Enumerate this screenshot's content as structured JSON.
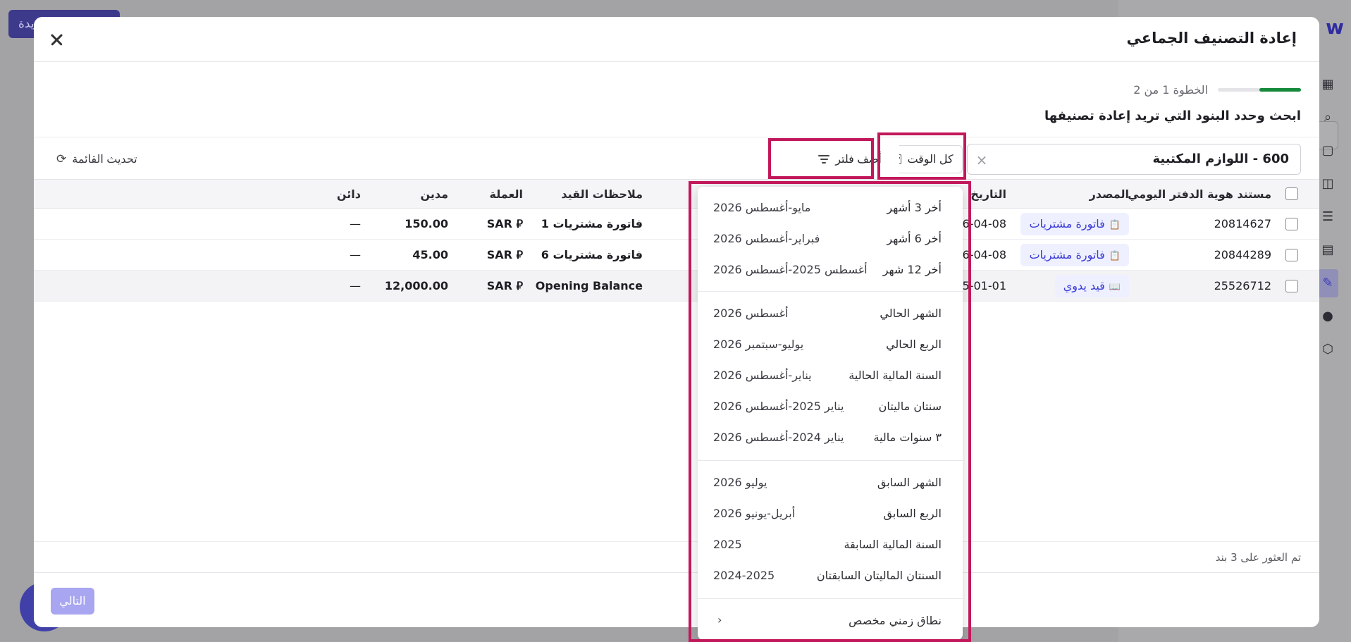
{
  "background": {
    "top_button_label": "يدة",
    "logo": "w"
  },
  "modal": {
    "title": "إعادة التصنيف الجماعي",
    "step": {
      "label": "الخطوة 1 من 2",
      "progress": 0.5
    },
    "section_title": "ابحث وحدد البنود التي تريد إعادة تصنيفها",
    "account_filter": {
      "value": "600 - اللوازم المكتبية"
    },
    "time_filter_label": "كل الوقت",
    "add_filter_label": "أضف فلتر",
    "refresh_label": "تحديث القائمة",
    "table": {
      "headers": {
        "doc_id": "مستند هوية الدفتر اليومي",
        "source": "المصدر",
        "date": "التاريخ",
        "notes": "ملاحظات القيد",
        "currency": "العملة",
        "debit": "مدين",
        "credit": "دائن"
      },
      "rows": [
        {
          "doc_id": "20814627",
          "source": "فاتورة مشتريات",
          "date": "6-04-08",
          "notes": "فاتورة مشتريات 1",
          "currency": "SAR ⃁",
          "debit": "150.00",
          "credit": "—"
        },
        {
          "doc_id": "20844289",
          "source": "فاتورة مشتريات",
          "date": "6-04-08",
          "notes": "فاتورة مشتريات 6",
          "currency": "SAR ⃁",
          "debit": "45.00",
          "credit": "—"
        },
        {
          "doc_id": "25526712",
          "source": "قيد يدوي",
          "date": "5-01-01",
          "notes": "Opening Balance",
          "currency": "SAR ⃁",
          "debit": "12,000.00",
          "credit": "—"
        }
      ]
    },
    "found_count": "تم العثور على 3 بند",
    "next_label": "التالي"
  },
  "time_dropdown": {
    "groups": [
      [
        {
          "label": "أخر 3 أشهر",
          "range": "مايو-أغسطس 2026"
        },
        {
          "label": "أخر 6 أشهر",
          "range": "فبراير-أغسطس 2026"
        },
        {
          "label": "أخر 12 شهر",
          "range": "أغسطس 2025-أغسطس 2026"
        }
      ],
      [
        {
          "label": "الشهر الحالي",
          "range": "أغسطس 2026"
        },
        {
          "label": "الربع الحالي",
          "range": "يوليو-سبتمبر 2026"
        },
        {
          "label": "السنة المالية الحالية",
          "range": "يناير-أغسطس 2026"
        },
        {
          "label": "سنتان ماليتان",
          "range": "يناير 2025-أغسطس 2026"
        },
        {
          "label": "٣ سنوات مالية",
          "range": "يناير 2024-أغسطس 2026"
        }
      ],
      [
        {
          "label": "الشهر السابق",
          "range": "يوليو 2026"
        },
        {
          "label": "الربع السابق",
          "range": "أبريل-يونيو 2026"
        },
        {
          "label": "السنة المالية السابقة",
          "range": "2025"
        },
        {
          "label": "السنتان الماليتان السابقتان",
          "range": "2024-2025"
        }
      ]
    ],
    "custom_range_label": "نطاق زمني مخصص"
  },
  "colors": {
    "highlight": "#c2185b",
    "accent": "#3b3bd6",
    "progress": "#168a3c"
  }
}
